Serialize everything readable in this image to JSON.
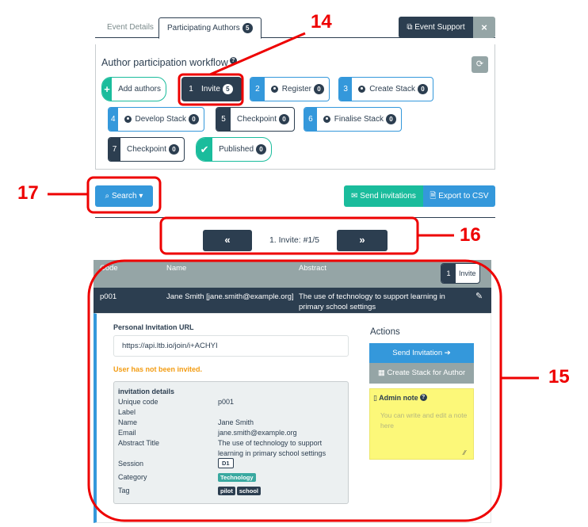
{
  "tabs": [
    {
      "label": "Event Details",
      "active": false
    },
    {
      "label": "Participating Authors",
      "active": true,
      "count": "5"
    }
  ],
  "header_buttons": {
    "event_support": "Event Support",
    "close": "×"
  },
  "workflow": {
    "title": "Author participation workflow",
    "help": "?",
    "refresh_icon": "refresh-icon",
    "add_authors": {
      "icon": "+",
      "label": "Add authors"
    },
    "steps": [
      {
        "num": "1",
        "label": "Invite",
        "count": "5",
        "user_icon": false
      },
      {
        "num": "2",
        "label": "Register",
        "count": "0",
        "user_icon": true
      },
      {
        "num": "3",
        "label": "Create Stack",
        "count": "0",
        "user_icon": true
      },
      {
        "num": "4",
        "label": "Develop Stack",
        "count": "0",
        "user_icon": true
      },
      {
        "num": "5",
        "label": "Checkpoint",
        "count": "0",
        "user_icon": false
      },
      {
        "num": "6",
        "label": "Finalise Stack",
        "count": "0",
        "user_icon": true
      },
      {
        "num": "7",
        "label": "Checkpoint",
        "count": "0",
        "user_icon": false
      }
    ],
    "published": {
      "icon": "✔",
      "label": "Published",
      "count": "0"
    }
  },
  "toolbar": {
    "search": "Search",
    "send_invitations": "Send invitations",
    "export_csv": "Export to CSV"
  },
  "pager": {
    "prev": "«",
    "label": "1. Invite:  #1/5",
    "next": "»"
  },
  "table": {
    "headers": [
      "Code",
      "Name",
      "Abstract"
    ],
    "stage": {
      "num": "1",
      "label": "Invite"
    },
    "row": {
      "code": "p001",
      "name": "Jane Smith [jane.smith@example.org]",
      "abstract": "The use of technology to support learning in primary school settings"
    }
  },
  "detail": {
    "url_label": "Personal Invitation URL",
    "url_value": "https://api.ltb.io/join/i+ACHYI",
    "warning": "User has not been invited.",
    "invitation_title": "invitation details",
    "fields": [
      {
        "key": "Unique code",
        "value": "p001"
      },
      {
        "key": "Label",
        "value": ""
      },
      {
        "key": "Name",
        "value": "Jane Smith"
      },
      {
        "key": "Email",
        "value": "jane.smith@example.org"
      },
      {
        "key": "Abstract Title",
        "value": "The use of technology to support learning in primary school settings"
      },
      {
        "key": "Session",
        "value": "D1"
      },
      {
        "key": "Category",
        "value": "Technology"
      },
      {
        "key": "Tag",
        "value": [
          "pilot",
          "school"
        ]
      }
    ],
    "actions_title": "Actions",
    "send_invitation": "Send Invitation ➔",
    "create_stack": "Create Stack for Author",
    "admin_note_title": "Admin note",
    "admin_note_placeholder": "You can write and edit a note here"
  },
  "annotations": [
    "14",
    "15",
    "16",
    "17"
  ]
}
